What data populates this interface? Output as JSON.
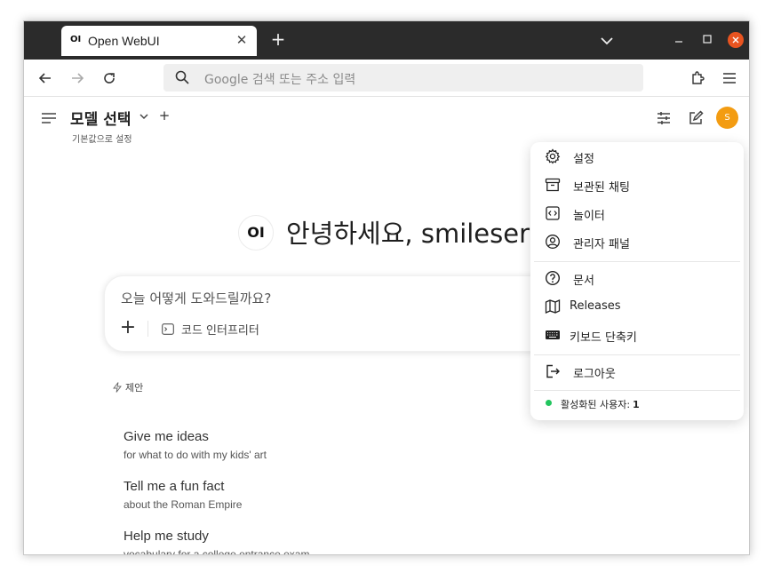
{
  "browser": {
    "tab": {
      "favicon_text": "OI",
      "title": "Open WebUI"
    },
    "url_placeholder": "Google 검색 또는 주소 입력"
  },
  "header": {
    "model_title": "모델 선택",
    "model_subtitle": "기본값으로 설정",
    "avatar_initial": "S",
    "avatar_color": "#f39c12"
  },
  "main": {
    "logo_text": "OI",
    "greeting": "안녕하세요, smileserv",
    "chat_placeholder": "오늘 어떻게 도와드릴까요?",
    "code_interpreter_label": "코드 인터프리터",
    "suggest_label": "제안",
    "suggestions": [
      {
        "title": "Give me ideas",
        "subtitle": "for what to do with my kids' art"
      },
      {
        "title": "Tell me a fun fact",
        "subtitle": "about the Roman Empire"
      },
      {
        "title": "Help me study",
        "subtitle": "vocabulary for a college entrance exam"
      }
    ]
  },
  "dropdown": {
    "items": [
      {
        "label": "설정",
        "icon": "gear-icon"
      },
      {
        "label": "보관된 채팅",
        "icon": "archive-icon"
      },
      {
        "label": "놀이터",
        "icon": "code-icon"
      },
      {
        "label": "관리자 패널",
        "icon": "user-circle-icon"
      },
      {
        "label": "문서",
        "icon": "question-icon"
      },
      {
        "label": "Releases",
        "icon": "map-icon"
      },
      {
        "label": "키보드 단축키",
        "icon": "keyboard-icon"
      },
      {
        "label": "로그아웃",
        "icon": "logout-icon"
      }
    ],
    "active_users_label": "활성화된 사용자:",
    "active_users_count": "1",
    "status_color": "#22c55e"
  }
}
